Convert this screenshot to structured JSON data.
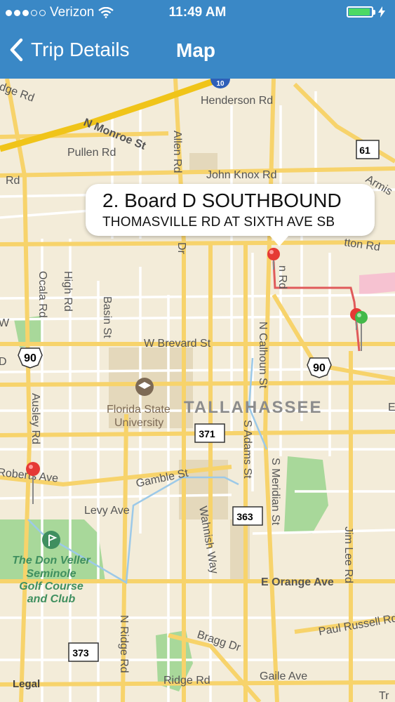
{
  "status_bar": {
    "carrier": "Verizon",
    "time": "11:49 AM",
    "signal_bars_filled": 3,
    "signal_bars_total": 5,
    "battery_level": 0.95,
    "icons": [
      "wifi-icon",
      "battery-icon",
      "charging-bolt-icon"
    ]
  },
  "nav": {
    "back_label": "Trip Details",
    "title": "Map",
    "back_icon": "chevron-left-icon"
  },
  "callout": {
    "title": "2. Board D SOUTHBOUND",
    "subtitle": "THOMASVILLE RD AT SIXTH AVE SB"
  },
  "map": {
    "city_label": "TALLAHASSEE",
    "street_labels": {
      "henderson": "Henderson Rd",
      "monroe": "N Monroe St",
      "pullen": "Pullen Rd",
      "allen": "Allen Rd",
      "johnknox": "John Knox Rd",
      "armistead": "Armis",
      "ridge_tl": "dge Rd",
      "rd_left": "Rd",
      "thomasville": "tton Rd",
      "ocala": "Ocala Rd",
      "high": "High Rd",
      "basin": "Basin St",
      "dr": "Dr",
      "brevard": "W Brevard St",
      "calhoun": "N Calhoun St",
      "n_rd": "n Rd",
      "ausley": "Ausley Rd",
      "adams": "S Adams St",
      "meridian": "S Meridian St",
      "roberts": "Roberts Ave",
      "gamble": "Gamble St",
      "levy": "Levy Ave",
      "wahnish": "Wahnish Way",
      "jimlee": "Jim Lee Rd",
      "orange": "E Orange Ave",
      "paulrussell": "Paul Russell Rd",
      "nridge": "N Ridge Rd",
      "bragg": "Bragg Dr",
      "ridge": "Ridge Rd",
      "gaile": "Gaile Ave",
      "e_edge": "E",
      "tr": "Tr",
      "w_left": "W",
      "d_left": "D"
    },
    "poi_labels": {
      "fsu": [
        "Florida State",
        "University"
      ],
      "golf": [
        "The Don Veller",
        "Seminole",
        "Golf Course",
        "and Club"
      ]
    },
    "route_shields": {
      "us90_left": "90",
      "us90_right": "90",
      "fl61": "61",
      "fl371": "371",
      "fl363": "363",
      "fl373": "373",
      "top_circle": "10"
    },
    "pins": [
      {
        "name": "red-pin-callout",
        "color": "#e53935"
      },
      {
        "name": "red-pin-east",
        "color": "#e53935"
      },
      {
        "name": "green-pin-east",
        "color": "#43b94a"
      },
      {
        "name": "red-pin-west",
        "color": "#e53935"
      }
    ],
    "route_color": "#e05a5a"
  },
  "legal_label": "Legal",
  "colors": {
    "nav_bar": "#3a88c6",
    "map_background": "#f3ecd9",
    "major_road": "#f7d36b",
    "highway": "#f0c419",
    "park": "#a8d89a"
  }
}
